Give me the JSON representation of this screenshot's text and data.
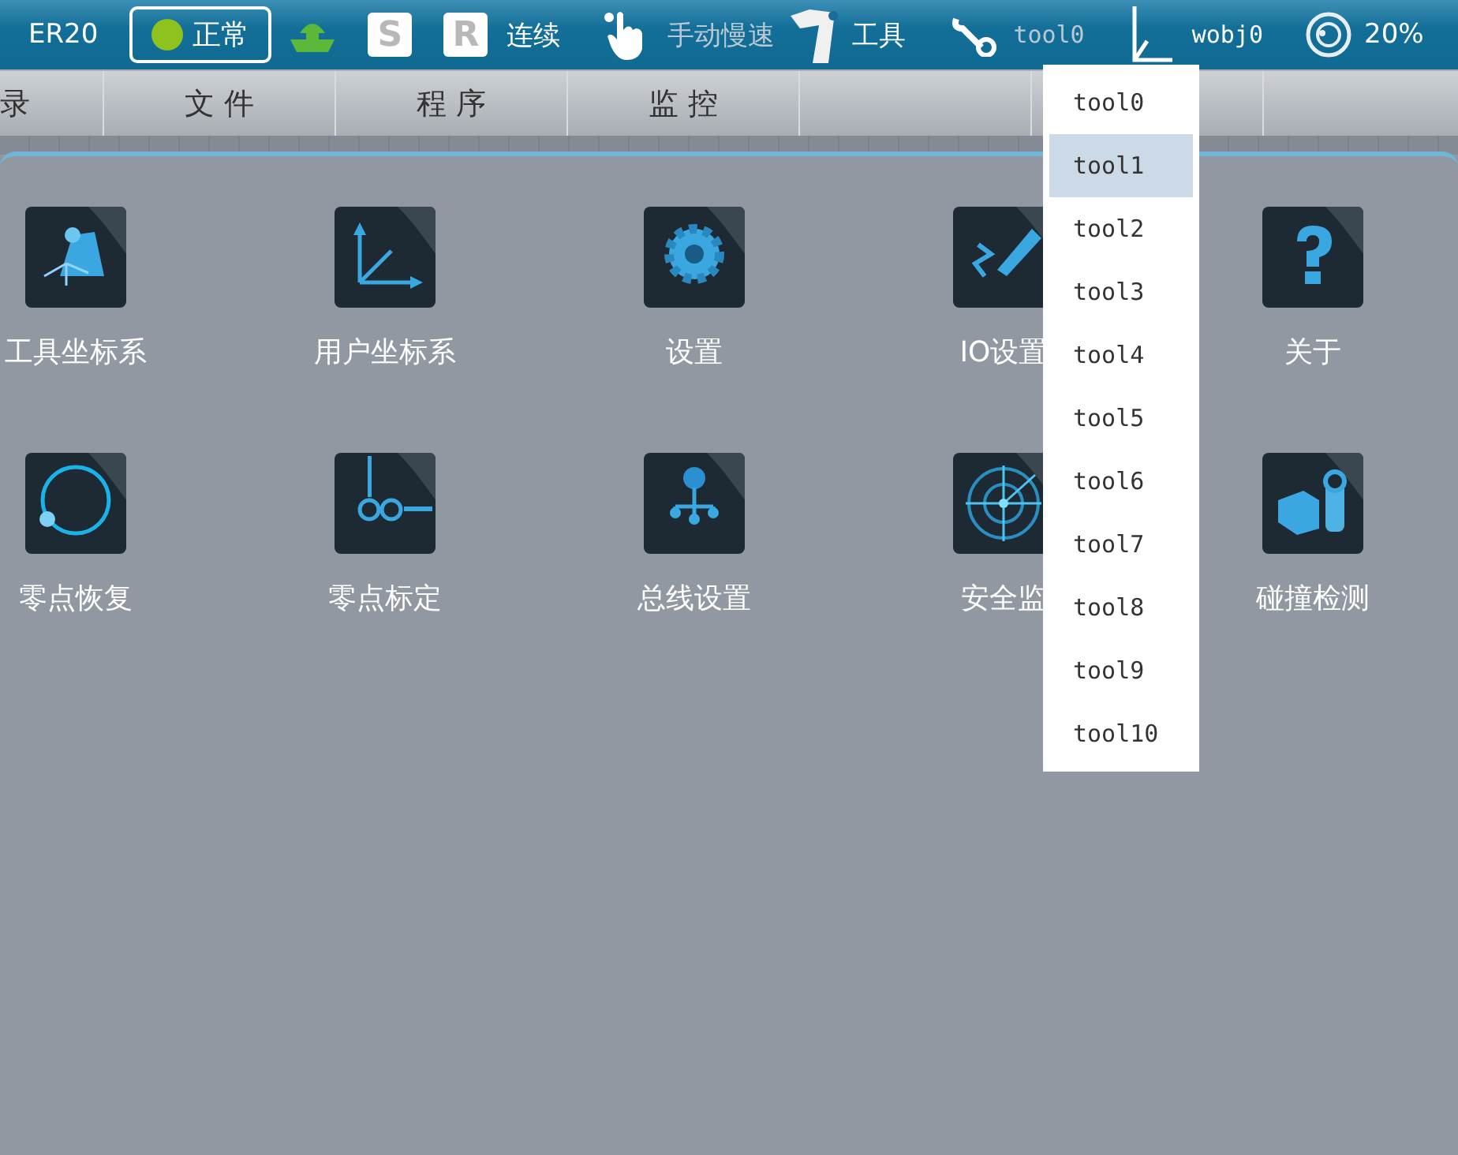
{
  "top_bar": {
    "robot": "ER20",
    "status": {
      "label": "正常",
      "color": "#8dc21f"
    },
    "s_key": "S",
    "r_key": "R",
    "run_mode": "连续",
    "speed_mode": "手动慢速",
    "tool_label": "工具",
    "tool": "tool0",
    "wobj": "wobj0",
    "speed": "20%"
  },
  "menu": [
    {
      "label": "录"
    },
    {
      "label": "文 件"
    },
    {
      "label": "程 序"
    },
    {
      "label": "监 控"
    }
  ],
  "tiles": [
    {
      "label": "工具坐标系",
      "kind": "tool-frame"
    },
    {
      "label": "用户坐标系",
      "kind": "user-frame"
    },
    {
      "label": "设置",
      "kind": "settings"
    },
    {
      "label": "IO设置",
      "kind": "io"
    },
    {
      "label": "关于",
      "kind": "about"
    },
    {
      "label": "零点恢复",
      "kind": "zero-restore"
    },
    {
      "label": "零点标定",
      "kind": "zero-calib"
    },
    {
      "label": "总线设置",
      "kind": "bus"
    },
    {
      "label": "安全监",
      "kind": "safety"
    },
    {
      "label": "碰撞检测",
      "kind": "collision"
    }
  ],
  "dropdown": {
    "items": [
      {
        "label": "tool0",
        "selected": false
      },
      {
        "label": "tool1",
        "selected": true
      },
      {
        "label": "tool2",
        "selected": false
      },
      {
        "label": "tool3",
        "selected": false
      },
      {
        "label": "tool4",
        "selected": false
      },
      {
        "label": "tool5",
        "selected": false
      },
      {
        "label": "tool6",
        "selected": false
      },
      {
        "label": "tool7",
        "selected": false
      },
      {
        "label": "tool8",
        "selected": false
      },
      {
        "label": "tool9",
        "selected": false
      },
      {
        "label": "tool10",
        "selected": false
      }
    ]
  }
}
